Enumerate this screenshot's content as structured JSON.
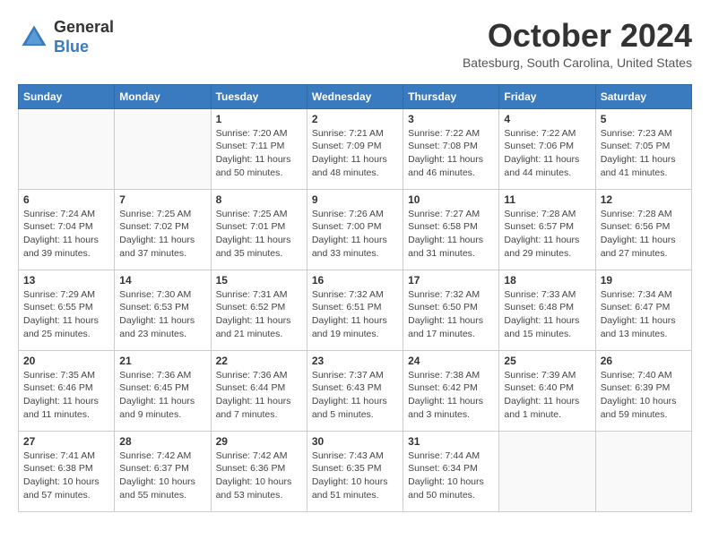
{
  "header": {
    "logo": {
      "general": "General",
      "blue": "Blue"
    },
    "title": "October 2024",
    "location": "Batesburg, South Carolina, United States"
  },
  "weekdays": [
    "Sunday",
    "Monday",
    "Tuesday",
    "Wednesday",
    "Thursday",
    "Friday",
    "Saturday"
  ],
  "weeks": [
    [
      {
        "day": "",
        "info": ""
      },
      {
        "day": "",
        "info": ""
      },
      {
        "day": "1",
        "info": "Sunrise: 7:20 AM\nSunset: 7:11 PM\nDaylight: 11 hours and 50 minutes."
      },
      {
        "day": "2",
        "info": "Sunrise: 7:21 AM\nSunset: 7:09 PM\nDaylight: 11 hours and 48 minutes."
      },
      {
        "day": "3",
        "info": "Sunrise: 7:22 AM\nSunset: 7:08 PM\nDaylight: 11 hours and 46 minutes."
      },
      {
        "day": "4",
        "info": "Sunrise: 7:22 AM\nSunset: 7:06 PM\nDaylight: 11 hours and 44 minutes."
      },
      {
        "day": "5",
        "info": "Sunrise: 7:23 AM\nSunset: 7:05 PM\nDaylight: 11 hours and 41 minutes."
      }
    ],
    [
      {
        "day": "6",
        "info": "Sunrise: 7:24 AM\nSunset: 7:04 PM\nDaylight: 11 hours and 39 minutes."
      },
      {
        "day": "7",
        "info": "Sunrise: 7:25 AM\nSunset: 7:02 PM\nDaylight: 11 hours and 37 minutes."
      },
      {
        "day": "8",
        "info": "Sunrise: 7:25 AM\nSunset: 7:01 PM\nDaylight: 11 hours and 35 minutes."
      },
      {
        "day": "9",
        "info": "Sunrise: 7:26 AM\nSunset: 7:00 PM\nDaylight: 11 hours and 33 minutes."
      },
      {
        "day": "10",
        "info": "Sunrise: 7:27 AM\nSunset: 6:58 PM\nDaylight: 11 hours and 31 minutes."
      },
      {
        "day": "11",
        "info": "Sunrise: 7:28 AM\nSunset: 6:57 PM\nDaylight: 11 hours and 29 minutes."
      },
      {
        "day": "12",
        "info": "Sunrise: 7:28 AM\nSunset: 6:56 PM\nDaylight: 11 hours and 27 minutes."
      }
    ],
    [
      {
        "day": "13",
        "info": "Sunrise: 7:29 AM\nSunset: 6:55 PM\nDaylight: 11 hours and 25 minutes."
      },
      {
        "day": "14",
        "info": "Sunrise: 7:30 AM\nSunset: 6:53 PM\nDaylight: 11 hours and 23 minutes."
      },
      {
        "day": "15",
        "info": "Sunrise: 7:31 AM\nSunset: 6:52 PM\nDaylight: 11 hours and 21 minutes."
      },
      {
        "day": "16",
        "info": "Sunrise: 7:32 AM\nSunset: 6:51 PM\nDaylight: 11 hours and 19 minutes."
      },
      {
        "day": "17",
        "info": "Sunrise: 7:32 AM\nSunset: 6:50 PM\nDaylight: 11 hours and 17 minutes."
      },
      {
        "day": "18",
        "info": "Sunrise: 7:33 AM\nSunset: 6:48 PM\nDaylight: 11 hours and 15 minutes."
      },
      {
        "day": "19",
        "info": "Sunrise: 7:34 AM\nSunset: 6:47 PM\nDaylight: 11 hours and 13 minutes."
      }
    ],
    [
      {
        "day": "20",
        "info": "Sunrise: 7:35 AM\nSunset: 6:46 PM\nDaylight: 11 hours and 11 minutes."
      },
      {
        "day": "21",
        "info": "Sunrise: 7:36 AM\nSunset: 6:45 PM\nDaylight: 11 hours and 9 minutes."
      },
      {
        "day": "22",
        "info": "Sunrise: 7:36 AM\nSunset: 6:44 PM\nDaylight: 11 hours and 7 minutes."
      },
      {
        "day": "23",
        "info": "Sunrise: 7:37 AM\nSunset: 6:43 PM\nDaylight: 11 hours and 5 minutes."
      },
      {
        "day": "24",
        "info": "Sunrise: 7:38 AM\nSunset: 6:42 PM\nDaylight: 11 hours and 3 minutes."
      },
      {
        "day": "25",
        "info": "Sunrise: 7:39 AM\nSunset: 6:40 PM\nDaylight: 11 hours and 1 minute."
      },
      {
        "day": "26",
        "info": "Sunrise: 7:40 AM\nSunset: 6:39 PM\nDaylight: 10 hours and 59 minutes."
      }
    ],
    [
      {
        "day": "27",
        "info": "Sunrise: 7:41 AM\nSunset: 6:38 PM\nDaylight: 10 hours and 57 minutes."
      },
      {
        "day": "28",
        "info": "Sunrise: 7:42 AM\nSunset: 6:37 PM\nDaylight: 10 hours and 55 minutes."
      },
      {
        "day": "29",
        "info": "Sunrise: 7:42 AM\nSunset: 6:36 PM\nDaylight: 10 hours and 53 minutes."
      },
      {
        "day": "30",
        "info": "Sunrise: 7:43 AM\nSunset: 6:35 PM\nDaylight: 10 hours and 51 minutes."
      },
      {
        "day": "31",
        "info": "Sunrise: 7:44 AM\nSunset: 6:34 PM\nDaylight: 10 hours and 50 minutes."
      },
      {
        "day": "",
        "info": ""
      },
      {
        "day": "",
        "info": ""
      }
    ]
  ]
}
